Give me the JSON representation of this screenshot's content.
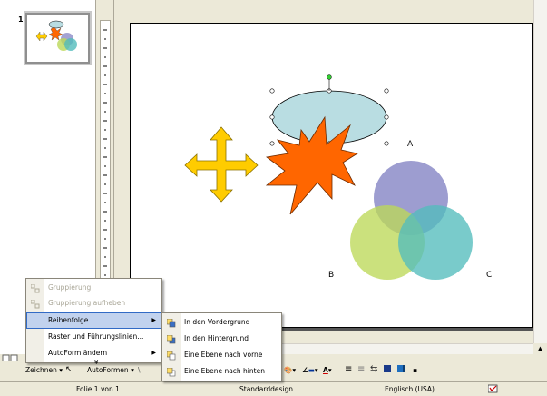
{
  "thumbnail": {
    "slide_number": "1"
  },
  "slide": {
    "label_a": "A",
    "label_b": "B",
    "label_c": "C"
  },
  "context_menu": {
    "items": [
      {
        "label": "Gruppierung",
        "disabled": true
      },
      {
        "label": "Gruppierung aufheben",
        "disabled": true
      },
      {
        "label": "Reihenfolge",
        "disabled": false,
        "has_submenu": true
      },
      {
        "label": "Raster und Führungslinien...",
        "disabled": false
      },
      {
        "label": "AutoForm ändern",
        "disabled": false,
        "has_submenu": true
      }
    ],
    "expand_marker": "¥"
  },
  "submenu": {
    "items": [
      {
        "label": "In den Vordergrund"
      },
      {
        "label": "In den Hintergrund"
      },
      {
        "label": "Eine Ebene nach vorne"
      },
      {
        "label": "Eine Ebene nach hinten"
      }
    ]
  },
  "toolbar": {
    "draw_label": "Zeichnen",
    "autoshapes_label": "AutoFormen"
  },
  "statusbar": {
    "slide_info": "Folie 1 von 1",
    "design": "Standarddesign",
    "language": "Englisch (USA)"
  },
  "colors": {
    "ellipse": "#b9dde2",
    "arrow": "#ffcc00",
    "star": "#ff6600",
    "circle_a": "#8c8cc8",
    "circle_b": "#bcd859",
    "circle_c": "#53bcbc",
    "menu_highlight": "#c1d2ee"
  }
}
